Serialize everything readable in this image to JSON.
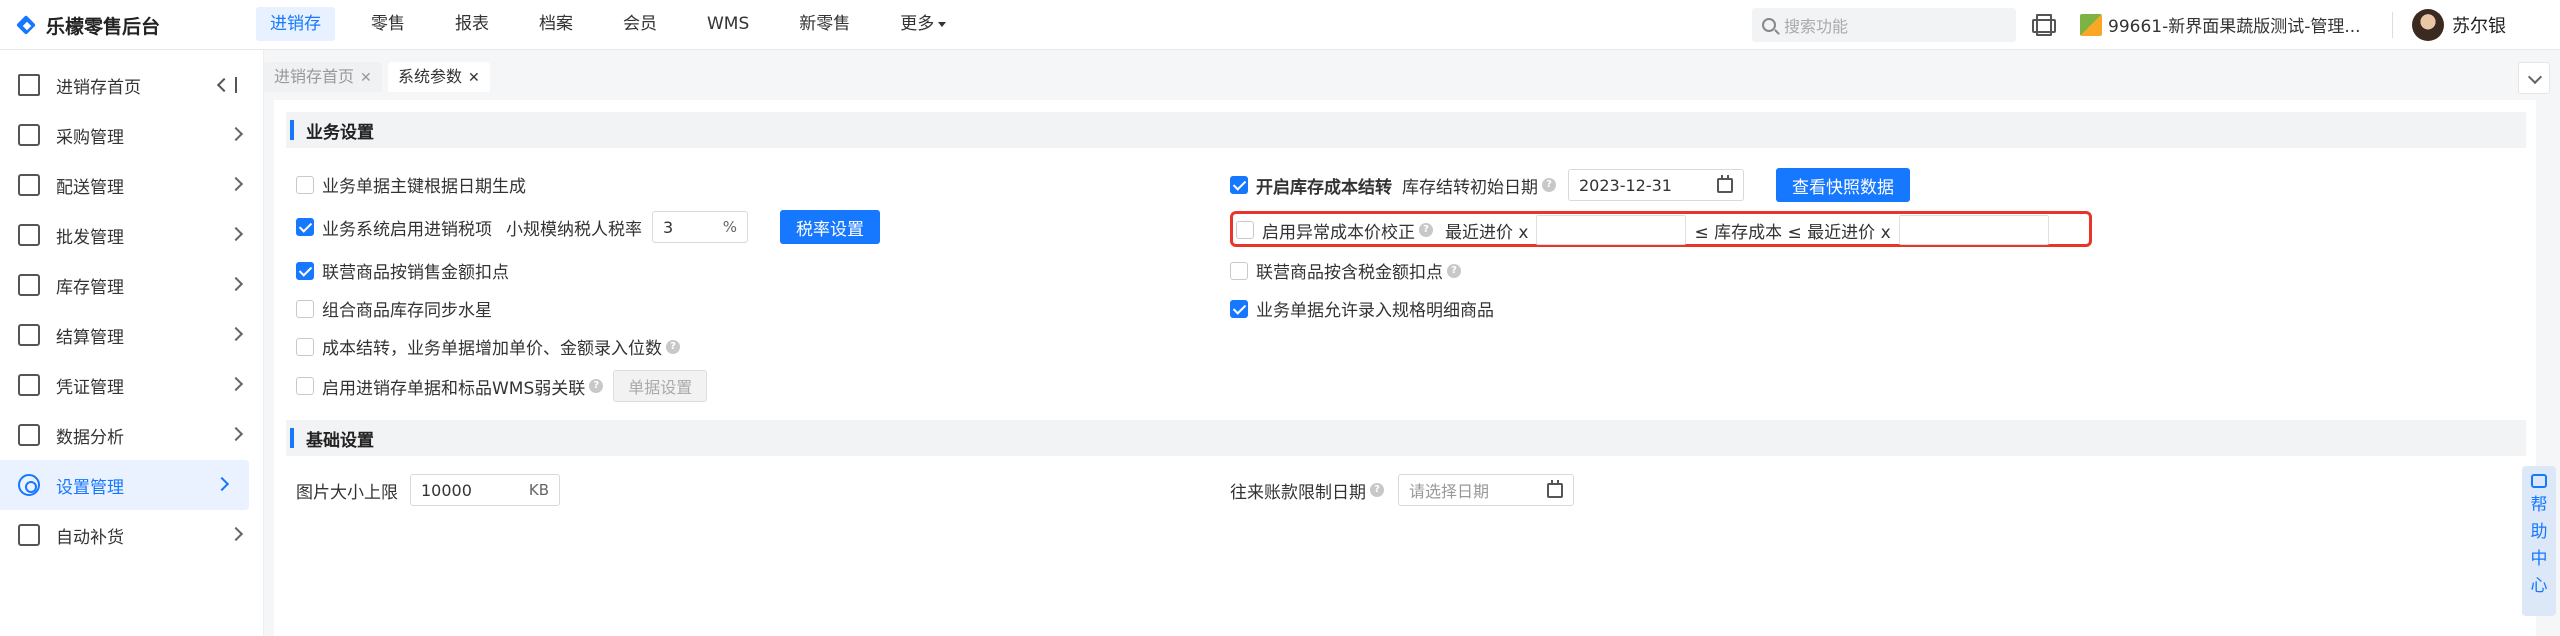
{
  "app": {
    "name": "乐檬零售后台"
  },
  "topnav": [
    {
      "label": "进销存",
      "active": true
    },
    {
      "label": "零售"
    },
    {
      "label": "报表"
    },
    {
      "label": "档案"
    },
    {
      "label": "会员"
    },
    {
      "label": "WMS"
    },
    {
      "label": "新零售"
    },
    {
      "label": "更多"
    }
  ],
  "search": {
    "placeholder": "搜索功能"
  },
  "store": {
    "name": "99661-新界面果蔬版测试-管理..."
  },
  "user": {
    "name": "苏尔银"
  },
  "sidebar": [
    {
      "label": "进销存首页",
      "icon": "home-icon"
    },
    {
      "label": "采购管理",
      "icon": "cart-icon"
    },
    {
      "label": "配送管理",
      "icon": "truck-icon"
    },
    {
      "label": "批发管理",
      "icon": "wholesale-icon"
    },
    {
      "label": "库存管理",
      "icon": "inventory-icon"
    },
    {
      "label": "结算管理",
      "icon": "settlement-icon"
    },
    {
      "label": "凭证管理",
      "icon": "voucher-icon"
    },
    {
      "label": "数据分析",
      "icon": "chart-icon"
    },
    {
      "label": "设置管理",
      "icon": "settings-icon",
      "active": true
    },
    {
      "label": "自动补货",
      "icon": "replenish-icon"
    }
  ],
  "tabs": [
    {
      "label": "进销存首页",
      "active": false
    },
    {
      "label": "系统参数",
      "active": true
    }
  ],
  "business": {
    "title": "业务设置",
    "left": {
      "doc_date_key": "业务单据主键根据日期生成",
      "tax_enable": "业务系统启用进销税项",
      "tax_rate_label": "小规模纳税人税率",
      "tax_rate_value": "3",
      "tax_rate_unit": "%",
      "tax_button": "税率设置",
      "joint_sales": "联营商品按销售金额扣点",
      "combo_stock": "组合商品库存同步水星",
      "cost_carry": "成本结转，业务单据增加单价、金额录入位数",
      "wms_link": "启用进销存单据和标品WMS弱关联",
      "doc_setting_button": "单据设置"
    },
    "right": {
      "stock_cost_carry": "开启库存成本结转",
      "initial_date_label": "库存结转初始日期",
      "initial_date_value": "2023-12-31",
      "snapshot_button": "查看快照数据",
      "abnormal_cost": "启用异常成本价校正",
      "recent_price_1": "最近进价 x",
      "stock_cost_mid": "≤ 库存成本 ≤ 最近进价 x",
      "joint_tax": "联营商品按含税金额扣点",
      "spec_detail": "业务单据允许录入规格明细商品"
    }
  },
  "basic": {
    "title": "基础设置",
    "image_limit_label": "图片大小上限",
    "image_limit_value": "10000",
    "image_limit_unit": "KB",
    "account_limit_label": "往来账款限制日期",
    "account_limit_placeholder": "请选择日期"
  },
  "help": {
    "chars": [
      "帮",
      "助",
      "中",
      "心"
    ]
  }
}
